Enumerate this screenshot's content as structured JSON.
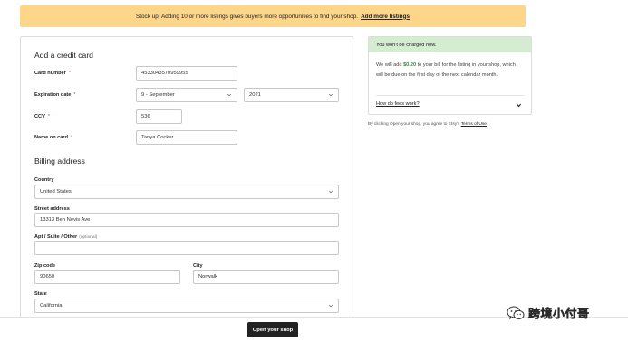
{
  "banner": {
    "message": "Stock up! Adding 10 or more listings gives buyers more opportunities to find your shop.",
    "link": "Add more listings"
  },
  "credit_card": {
    "title": "Add a credit card",
    "card_number_label": "Card number",
    "card_number_value": "4533043570959955",
    "expiration_label": "Expiration date",
    "exp_month": "9 - September",
    "exp_year": "2021",
    "ccv_label": "CCV",
    "ccv_value": "536",
    "name_label": "Name on card",
    "name_value": "Tanya Cocker",
    "required_mark": "*"
  },
  "billing": {
    "title": "Billing address",
    "country_label": "Country",
    "country_value": "United States",
    "street_label": "Street address",
    "street_value": "13313 Ben Nevis Ave",
    "apt_label": "Apt / Suite / Other",
    "apt_optional": "(optional)",
    "apt_value": "",
    "zip_label": "Zip code",
    "zip_value": "90650",
    "city_label": "City",
    "city_value": "Norwalk",
    "state_label": "State",
    "state_value": "California"
  },
  "summary": {
    "header": "You won't be charged now.",
    "body_prefix": "We will add ",
    "amount": "$0.20",
    "body_suffix": " to your bill for the listing in your shop, which will be due on the first day of the next calendar month.",
    "faq_link": "How do fees work?"
  },
  "terms": {
    "prefix": "By clicking Open your shop, you agree to Etsy's ",
    "link": "Terms of Use"
  },
  "footer": {
    "open_button": "Open your shop"
  },
  "watermark": {
    "text": "跨境小付哥"
  },
  "colors": {
    "banner_bg": "#fdd68a",
    "summary_header_bg": "#d4ecd0",
    "amount_green": "#2a8a3e",
    "primary_button": "#222222",
    "required_red": "#d14040"
  },
  "icons": {
    "select_chevron": "chevron-down-icon",
    "faq_chevron": "chevron-down-icon",
    "watermark_logo": "wechat-logo-icon"
  }
}
